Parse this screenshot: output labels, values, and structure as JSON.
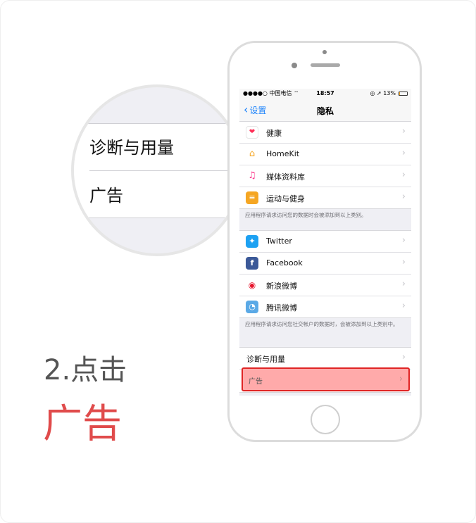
{
  "status_bar": {
    "carrier": "●●●●○ 中国电信 ⌔",
    "time": "18:57",
    "right": "◎ ➚ 13%",
    "battery_level": 0.13
  },
  "nav": {
    "back_label": "设置",
    "title": "隐私"
  },
  "group1": {
    "items": [
      {
        "label": "健康",
        "icon": "health-icon",
        "color": "#ffffff"
      },
      {
        "label": "HomeKit",
        "icon": "home-icon",
        "color": "#ffffff"
      },
      {
        "label": "媒体资料库",
        "icon": "music-icon",
        "color": "#ffffff"
      },
      {
        "label": "运动与健身",
        "icon": "motion-icon",
        "color": "#f5a623"
      }
    ],
    "footnote": "应用程序请求访问您的数据时会被添加到以上类别。"
  },
  "group2": {
    "items": [
      {
        "label": "Twitter",
        "icon": "twitter-icon",
        "color": "#1da1f2"
      },
      {
        "label": "Facebook",
        "icon": "facebook-icon",
        "color": "#3b5998"
      },
      {
        "label": "新浪微博",
        "icon": "weibo-icon",
        "color": "#ffffff"
      },
      {
        "label": "腾讯微博",
        "icon": "tencent-weibo-icon",
        "color": "#5aa9e6"
      }
    ],
    "footnote": "应用程序请求访问您社交帐户的数据时，会被添加到以上类别中。"
  },
  "group3": {
    "items": [
      {
        "label": "诊断与用量"
      },
      {
        "label": "广告",
        "highlighted": true
      }
    ]
  },
  "magnifier": {
    "row1": "诊断与用量",
    "row2": "广告"
  },
  "instruction": {
    "step": "2.点击",
    "action": "广告"
  },
  "colors": {
    "accent": "#1a82fb",
    "highlight_fill": "#ffaaaa",
    "highlight_border": "#e02424",
    "action_text": "#e04b4b"
  }
}
